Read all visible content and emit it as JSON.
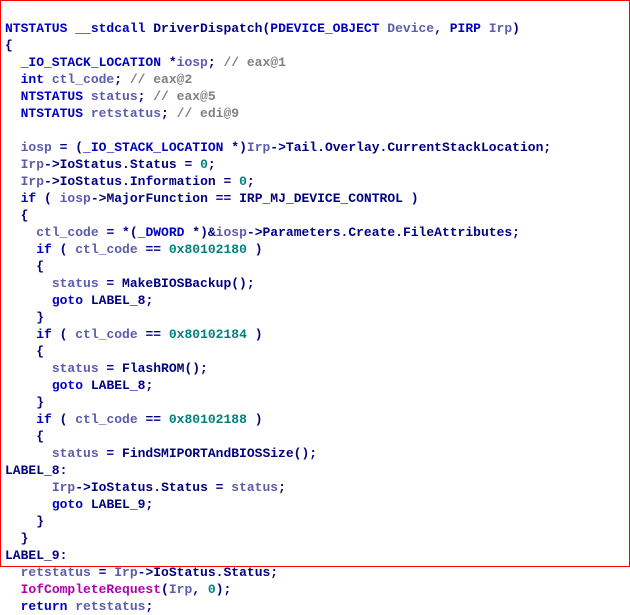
{
  "sig": {
    "ret": "NTSTATUS ",
    "cc": "__stdcall ",
    "name": "DriverDispatch",
    "open": "(",
    "p1t": "PDEVICE_OBJECT ",
    "p1n": "Device",
    "sep": ", ",
    "p2t": "PIRP ",
    "p2n": "Irp",
    "close": ")"
  },
  "bopen": "{",
  "decl": {
    "d1t": "  _IO_STACK_LOCATION ",
    "d1s": "*",
    "d1n": "iosp",
    "d1e": "; ",
    "d1c": "// eax@1",
    "d2t": "  int ",
    "d2n": "ctl_code",
    "d2e": "; ",
    "d2c": "// eax@2",
    "d3t": "  NTSTATUS ",
    "d3n": "status",
    "d3e": "; ",
    "d3c": "// eax@5",
    "d4t": "  NTSTATUS ",
    "d4n": "retstatus",
    "d4e": "; ",
    "d4c": "// edi@9"
  },
  "blank": "",
  "l1": {
    "a": "  ",
    "v": "iosp",
    "b": " = (",
    "t": "_IO_STACK_LOCATION ",
    "c": "*)",
    "ir": "Irp",
    "d": "->",
    "e": "Tail",
    "f": ".",
    "g": "Overlay",
    "h": ".",
    "i": "CurrentStackLocation",
    "j": ";"
  },
  "l2": {
    "a": "  ",
    "ir": "Irp",
    "b": "->",
    "c": "IoStatus",
    "d": ".",
    "e": "Status",
    "f": " = ",
    "n": "0",
    "g": ";"
  },
  "l3": {
    "a": "  ",
    "ir": "Irp",
    "b": "->",
    "c": "IoStatus",
    "d": ".",
    "e": "Information",
    "f": " = ",
    "n": "0",
    "g": ";"
  },
  "l4": {
    "a": "  ",
    "kw": "if",
    "b": " ( ",
    "v": "iosp",
    "c": "->",
    "d": "MajorFunction",
    "e": " == ",
    "m": "IRP_MJ_DEVICE_CONTROL",
    "f": " )"
  },
  "l5": "  {",
  "l6": {
    "a": "    ",
    "v": "ctl_code",
    "b": " = *(",
    "t": "_DWORD ",
    "c": "*)&",
    "w": "iosp",
    "d": "->",
    "e": "Parameters",
    "f": ".",
    "g": "Create",
    "h": ".",
    "i": "FileAttributes",
    "j": ";"
  },
  "l7": {
    "a": "    ",
    "kw": "if",
    "b": " ( ",
    "v": "ctl_code",
    "c": " == ",
    "n": "0x80102180",
    "d": " )"
  },
  "l8": "    {",
  "l9": {
    "a": "      ",
    "v": "status",
    "b": " = ",
    "fn": "MakeBIOSBackup",
    "c": "();"
  },
  "l10": {
    "a": "      ",
    "kw": "goto",
    "b": " ",
    "lbl": "LABEL_8",
    "c": ";"
  },
  "l11": "    }",
  "l12": {
    "a": "    ",
    "kw": "if",
    "b": " ( ",
    "v": "ctl_code",
    "c": " == ",
    "n": "0x80102184",
    "d": " )"
  },
  "l13": "    {",
  "l14": {
    "a": "      ",
    "v": "status",
    "b": " = ",
    "fn": "FlashROM",
    "c": "();"
  },
  "l15": {
    "a": "      ",
    "kw": "goto",
    "b": " ",
    "lbl": "LABEL_8",
    "c": ";"
  },
  "l16": "    }",
  "l17": {
    "a": "    ",
    "kw": "if",
    "b": " ( ",
    "v": "ctl_code",
    "c": " == ",
    "n": "0x80102188",
    "d": " )"
  },
  "l18": "    {",
  "l19": {
    "a": "      ",
    "v": "status",
    "b": " = ",
    "fn": "FindSMIPORTAndBIOSSize",
    "c": "();"
  },
  "lbl8": "LABEL_8:",
  "l20": {
    "a": "      ",
    "ir": "Irp",
    "b": "->",
    "c": "IoStatus",
    "d": ".",
    "e": "Status",
    "f": " = ",
    "v": "status",
    "g": ";"
  },
  "l21": {
    "a": "      ",
    "kw": "goto",
    "b": " ",
    "lbl": "LABEL_9",
    "c": ";"
  },
  "l22": "    }",
  "l23": "  }",
  "lbl9": "LABEL_9:",
  "l24": {
    "a": "  ",
    "v": "retstatus",
    "b": " = ",
    "ir": "Irp",
    "c": "->",
    "d": "IoStatus",
    "e": ".",
    "f": "Status",
    "g": ";"
  },
  "l25": {
    "a": "  ",
    "fn": "IofCompleteRequest",
    "b": "(",
    "ir": "Irp",
    "c": ", ",
    "n": "0",
    "d": ");"
  },
  "l26": {
    "a": "  ",
    "kw": "return",
    "b": " ",
    "v": "retstatus",
    "c": ";"
  }
}
